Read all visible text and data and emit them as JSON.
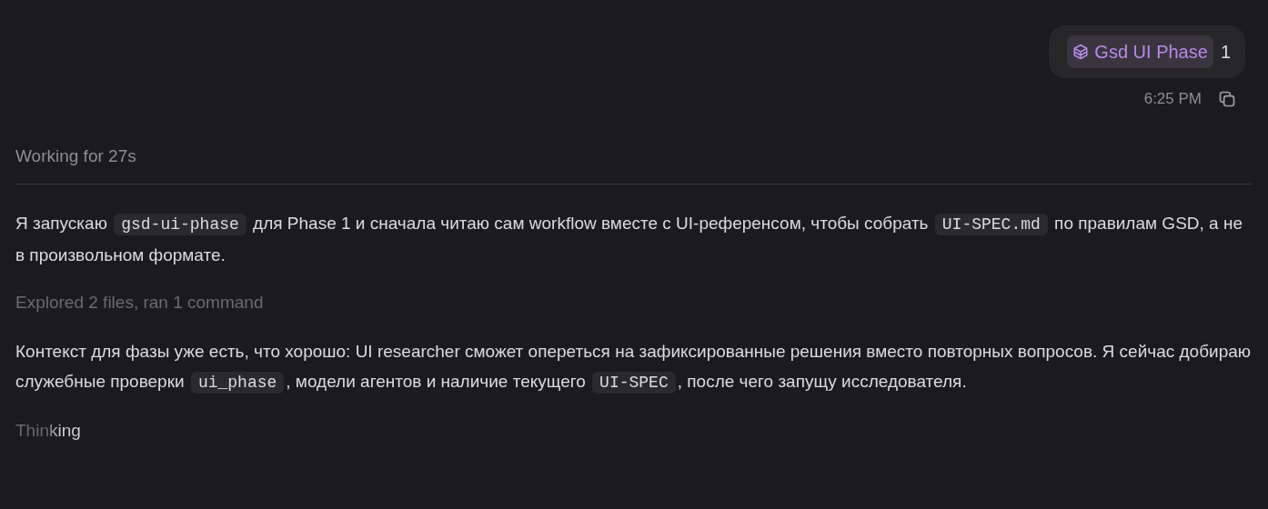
{
  "user_message": {
    "chip": {
      "label": "Gsd UI Phase"
    },
    "text": "1",
    "time": "6:25 PM"
  },
  "status": "Working for 27s",
  "blocks": [
    {
      "kind": "paragraph",
      "segments": [
        {
          "kind": "text",
          "text": "Я запускаю "
        },
        {
          "kind": "code",
          "text": "gsd-ui-phase"
        },
        {
          "kind": "text",
          "text": " для Phase 1 и сначала читаю сам workflow вместе с UI-референсом, чтобы собрать "
        },
        {
          "kind": "code",
          "text": "UI-SPEC.md"
        },
        {
          "kind": "text",
          "text": " по правилам GSD, а не в произвольном формате."
        }
      ]
    },
    {
      "kind": "summary",
      "text": "Explored 2 files, ran 1 command"
    },
    {
      "kind": "paragraph",
      "segments": [
        {
          "kind": "text",
          "text": "Контекст для фазы уже есть, что хорошо: UI researcher сможет опереться на зафиксированные решения вместо повторных вопросов. Я сейчас добираю служебные проверки "
        },
        {
          "kind": "code",
          "text": "ui_phase"
        },
        {
          "kind": "text",
          "text": ", модели агентов и наличие текущего "
        },
        {
          "kind": "code",
          "text": "UI-SPEC"
        },
        {
          "kind": "text",
          "text": ", после чего запущу исследователя."
        }
      ]
    },
    {
      "kind": "thinking",
      "text": "Thinking"
    }
  ]
}
